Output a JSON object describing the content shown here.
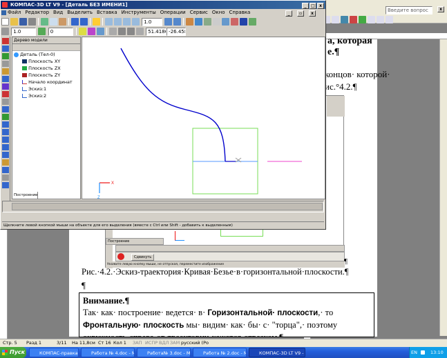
{
  "word": {
    "search_placeholder": "Введите вопрос",
    "line1": "а, которая",
    "line2": "е.¶",
    "line3": "концов· которой·",
    "line4": "ис.°4.2.¶",
    "caption": "Рис.·4.2.·Эскиз-траектория·Кривая·Безье·в·горизонтальной·плоскости.¶",
    "para_mark": "¶",
    "note_title": "Внимание.¶",
    "note_text_1": "Так· как· построение· ведется· в·",
    "note_bold_1": "Горизонтальной· плоскости",
    "note_text_2": ",· то",
    "note_bold_2": "Фронтальную· плоскость",
    "note_text_3": "мы· видим· как· бы· с· \"торца\",· поэтому",
    "note_line3": "окружность·справа·от·траектории·кажется·отрезком.¶",
    "status": {
      "page": "Стр. 5",
      "section": "Разд 1",
      "pages": "3/11",
      "at": "На 11,8см",
      "line": "Ст 16",
      "col": "Кол 1",
      "rec": "ЗАП",
      "trk": "ИСПР",
      "ext": "ВДЛ",
      "ovr": "ЗАМ",
      "lang": "русский (Ро"
    },
    "inner": {
      "tab": "Построение",
      "status": "Укажите левую кнопку мыши, не отпуская, переместите изображение",
      "btn": "Сдвинуть"
    }
  },
  "kompas": {
    "title": "КОМПАС-3D LT V9 - [Деталь БЕЗ ИМЕНИ1]",
    "menu": [
      "Файл",
      "Редактор",
      "Вид",
      "Выделить",
      "Вставка",
      "Инструменты",
      "Операции",
      "Сервис",
      "Окно",
      "Справка"
    ],
    "line_width": "1.0",
    "layer": "0",
    "zoom": "1.0",
    "coord_x": "51.4186",
    "coord_y": "-26.458",
    "tree_title": "Дерево модели",
    "tree": [
      "Деталь (Тел-0)",
      "Плоскость XY",
      "Плоскость ZX",
      "Плоскость ZY",
      "Начало координат",
      "Эскиз:1",
      "Эскиз:2"
    ],
    "tab": "Построение",
    "status": "Щелкните левой кнопкой мыши на объекте для его выделения (вместе с Ctrl или Shift - добавить к выделенным)",
    "axis_x": "X",
    "axis_z": "Z"
  },
  "taskbar": {
    "start": "Пуск",
    "items": [
      "КОМПАС-правка",
      "Работа № 4.doc - Micro...",
      "Работа№ 3.doc - Micro...",
      "Работа № 2.doc - Micro...",
      "КОМПАС-3D LT V9 - [..."
    ],
    "clock": "13:10",
    "lang": "EN"
  },
  "colors": {
    "curve": "#0000cc",
    "green": "#77dd55",
    "axis_blue": "#1e90ff",
    "axis_red": "#ee1111",
    "title": "#0a246a",
    "taskbar": "#245edb",
    "start": "#3c9a31"
  }
}
